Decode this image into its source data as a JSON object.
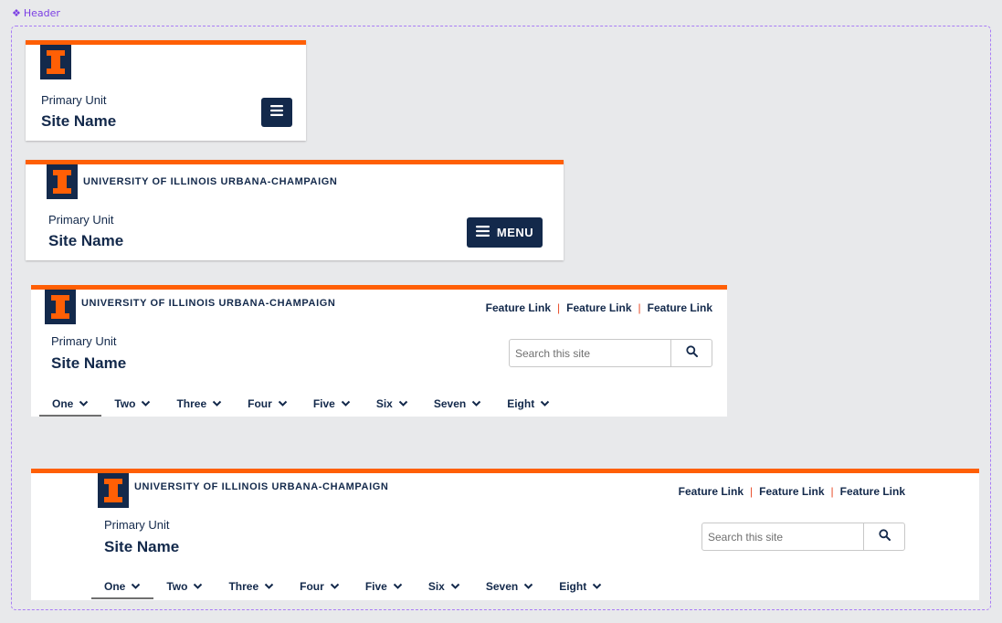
{
  "frame_label": "Header",
  "colors": {
    "orange": "#ff5f05",
    "navy": "#13294b",
    "separator": "#e84a27"
  },
  "icons": {
    "logo": "block-i-icon",
    "menu": "hamburger-icon",
    "search": "search-icon",
    "chevron": "chevron-down-icon"
  },
  "mobile": {
    "primary_unit": "Primary Unit",
    "site_name": "Site Name"
  },
  "tablet": {
    "wordmark": "UNIVERSITY OF ILLINOIS URBANA-CHAMPAIGN",
    "primary_unit": "Primary Unit",
    "site_name": "Site Name",
    "menu_label": "MENU"
  },
  "desktop": {
    "wordmark": "UNIVERSITY OF ILLINOIS URBANA-CHAMPAIGN",
    "primary_unit": "Primary Unit",
    "site_name": "Site Name",
    "feature_links": [
      "Feature Link",
      "Feature Link",
      "Feature Link"
    ],
    "search_placeholder": "Search this site",
    "nav": [
      "One",
      "Two",
      "Three",
      "Four",
      "Five",
      "Six",
      "Seven",
      "Eight"
    ],
    "active_nav": "One"
  },
  "wide": {
    "wordmark": "UNIVERSITY OF ILLINOIS URBANA-CHAMPAIGN",
    "primary_unit": "Primary Unit",
    "site_name": "Site Name",
    "feature_links": [
      "Feature Link",
      "Feature Link",
      "Feature Link"
    ],
    "search_placeholder": "Search this site",
    "nav": [
      "One",
      "Two",
      "Three",
      "Four",
      "Five",
      "Six",
      "Seven",
      "Eight"
    ],
    "active_nav": "One"
  }
}
